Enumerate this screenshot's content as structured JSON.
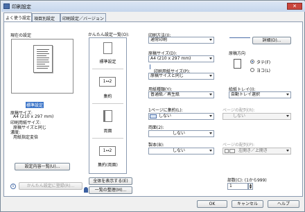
{
  "window": {
    "title": "印刷設定"
  },
  "tabs": [
    {
      "label": "よく使う設定"
    },
    {
      "label": "項目別設定"
    },
    {
      "label": "印刷設定／バージョン"
    }
  ],
  "current_settings": {
    "heading": "現在の設定",
    "highlight": "標準設定",
    "details": [
      "原稿サイズ:",
      "A4 (210 x 297 mm)",
      "印刷用紙サイズ:",
      "原稿サイズと同じ",
      "濃度:",
      "用紙指定変倍"
    ],
    "list_button": "設定内容一覧(U)...",
    "register_button": "かんたん設定に登録(R)..."
  },
  "quick_list": {
    "heading": "かんたん設定一覧(O):",
    "items": [
      {
        "label": "標準設定",
        "icon": ""
      },
      {
        "label": "集約",
        "icon": "1↔2"
      },
      {
        "label": "両面",
        "icon": ""
      },
      {
        "label": "集約(両面)",
        "icon": "1↔2"
      }
    ],
    "show_all_button": "全体を表示する(E)",
    "manage_button": "一覧の整理(M)..."
  },
  "print_method": {
    "label": "印刷方法(J):",
    "value": "通常印刷",
    "detail_button": "詳細(D)..."
  },
  "original_size": {
    "label": "原稿サイズ(D):",
    "value": "A4 (210 x 297 mm)"
  },
  "paper_size": {
    "label": "印刷用紙サイズ(P):",
    "value": "原稿サイズと同じ"
  },
  "orientation": {
    "label": "原稿方向",
    "options": [
      {
        "label": "タテ(F)",
        "selected": true
      },
      {
        "label": "ヨコ(L)",
        "selected": false
      }
    ]
  },
  "paper_type": {
    "label": "用紙種類(Y):",
    "value": "普通紙／再生紙"
  },
  "paper_tray": {
    "label": "給紙トレイ(I):",
    "value": "自動トレイ選択"
  },
  "pages_per_sheet": {
    "label": "1ページに集約(L):",
    "value": "しない"
  },
  "page_order": {
    "label": "ページの配列(R):",
    "value": "しない"
  },
  "duplex": {
    "label": "両面(2):",
    "value": "しない"
  },
  "booklet": {
    "label": "製本(B):",
    "value": "しない"
  },
  "binding_order": {
    "label": "ページの配列(P):",
    "value": "左開き／上開き"
  },
  "copies": {
    "label": "部数(C): (1から999)",
    "value": "1"
  },
  "footer": {
    "ok": "OK",
    "cancel": "キャンセル",
    "help": "ヘルプ"
  },
  "icons": {
    "app": "printer-icon",
    "info": "info-icon"
  }
}
